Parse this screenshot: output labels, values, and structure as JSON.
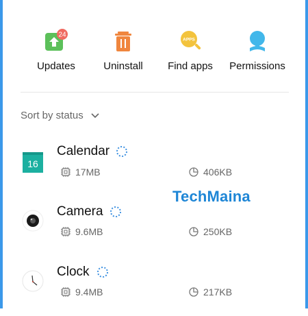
{
  "quick_actions": {
    "updates": {
      "label": "Updates",
      "badge": "24",
      "icon": "update-arrow-icon",
      "color": "#5cc05a",
      "badge_color": "#f06a60"
    },
    "uninstall": {
      "label": "Uninstall",
      "icon": "trash-icon",
      "color": "#f0863e"
    },
    "find_apps": {
      "label": "Find apps",
      "icon": "apps-search-icon",
      "icon_text": "APPS",
      "color": "#f3c33d"
    },
    "permissions": {
      "label": "Permissions",
      "icon": "permissions-icon",
      "color": "#42b7ea"
    }
  },
  "sort": {
    "label": "Sort by status",
    "icon": "chevron-down-icon"
  },
  "apps": [
    {
      "name": "Calendar",
      "icon_text": "16",
      "storage": "17MB",
      "data": "406KB"
    },
    {
      "name": "Camera",
      "storage": "9.6MB",
      "data": "250KB"
    },
    {
      "name": "Clock",
      "storage": "9.4MB",
      "data": "217KB"
    }
  ],
  "watermark": "TechMaina",
  "colors": {
    "frame": "#3b99ea",
    "calendar": "#1cb0a0",
    "loading": "#3a8fe0"
  }
}
